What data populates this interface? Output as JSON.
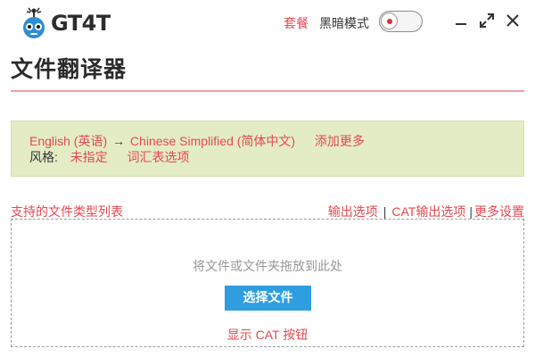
{
  "header": {
    "logo_text": "GT4T",
    "plan_link": "套餐",
    "dark_mode_label": "黑暗模式",
    "dark_mode_on": false
  },
  "window_controls": {
    "icons": [
      "minimize-icon",
      "maximize-icon",
      "close-icon"
    ]
  },
  "page": {
    "title": "文件翻译器"
  },
  "language_panel": {
    "source_language": "English (英语)",
    "arrow": "→",
    "target_language": "Chinese Simplified (简体中文)",
    "add_more": "添加更多",
    "style_label": "风格:",
    "style_value": "未指定",
    "glossary_options": "词汇表选项"
  },
  "links": {
    "supported_types": "支持的文件类型列表",
    "output_options": "输出选项",
    "cat_output_options": "CAT输出选项",
    "more_settings": "更多设置",
    "separator": "|"
  },
  "dropzone": {
    "hint": "将文件或文件夹拖放到此处",
    "select_button": "选择文件",
    "show_cat_button": "显示 CAT 按钮"
  },
  "colors": {
    "accent": "#e8484f",
    "panel_bg": "#e3ecc5",
    "button_blue": "#2f9ee0",
    "title_rule": "#f0a3a8"
  }
}
